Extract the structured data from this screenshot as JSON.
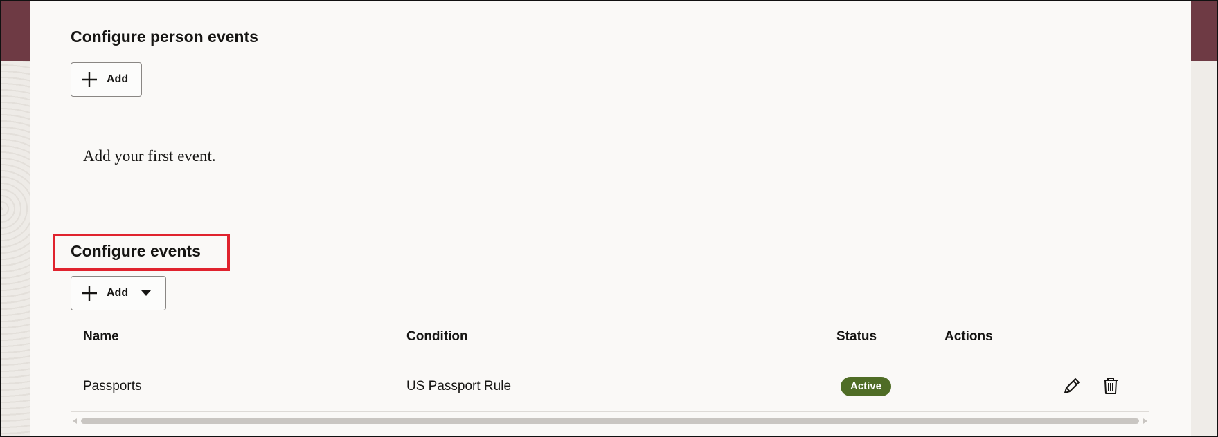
{
  "person_events": {
    "title": "Configure person events",
    "add_label": "Add",
    "empty_message": "Add your first event."
  },
  "events": {
    "title": "Configure events",
    "add_label": "Add",
    "columns": [
      "Name",
      "Condition",
      "Status",
      "Actions"
    ],
    "rows": [
      {
        "name": "Passports",
        "condition": "US Passport Rule",
        "status": "Active"
      }
    ]
  },
  "icons": {
    "add": "plus-icon",
    "dropdown": "caret-down-icon",
    "edit": "pencil-icon",
    "delete": "trash-icon"
  },
  "colors": {
    "brand_band": "#6e3a44",
    "status_active": "#4f6d26",
    "highlight": "#e0232e"
  }
}
